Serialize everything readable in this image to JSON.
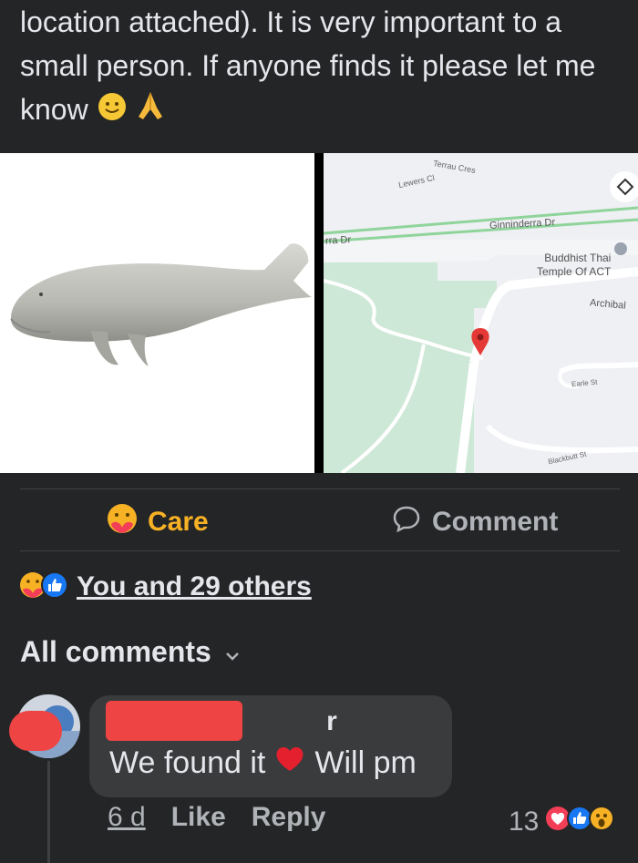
{
  "post": {
    "lines": [
      "location attached). It is very important to a",
      "small person. If anyone finds it please let me",
      "know"
    ]
  },
  "map": {
    "streets": {
      "lewers": "Lewers Cl",
      "terrau": "Terrau Cres",
      "ginninderra_right": "Ginninderra Dr",
      "ginninderra_left": "rra Dr",
      "archibald": "Archibal",
      "earle": "Earle St",
      "blackbutt": "Blackbutt St"
    },
    "poi": [
      "Buddhist Thai",
      "Temple Of ACT"
    ]
  },
  "actions": {
    "care": "Care",
    "comment": "Comment"
  },
  "reactions": {
    "summary": "You and 29 others"
  },
  "comments_header": {
    "label": "All comments"
  },
  "comment": {
    "author_suffix": "r",
    "text_before": "We found it",
    "text_after": "Will pm",
    "time": "6 d",
    "like": "Like",
    "reply": "Reply",
    "reaction_count": "13"
  },
  "colors": {
    "background": "#242526",
    "bubble": "#3a3b3c",
    "text_primary": "#e4e6eb",
    "text_secondary": "#b0b3b8",
    "like_blue": "#1877f2",
    "love_red": "#f33e58",
    "care_yellow": "#f7b125"
  }
}
